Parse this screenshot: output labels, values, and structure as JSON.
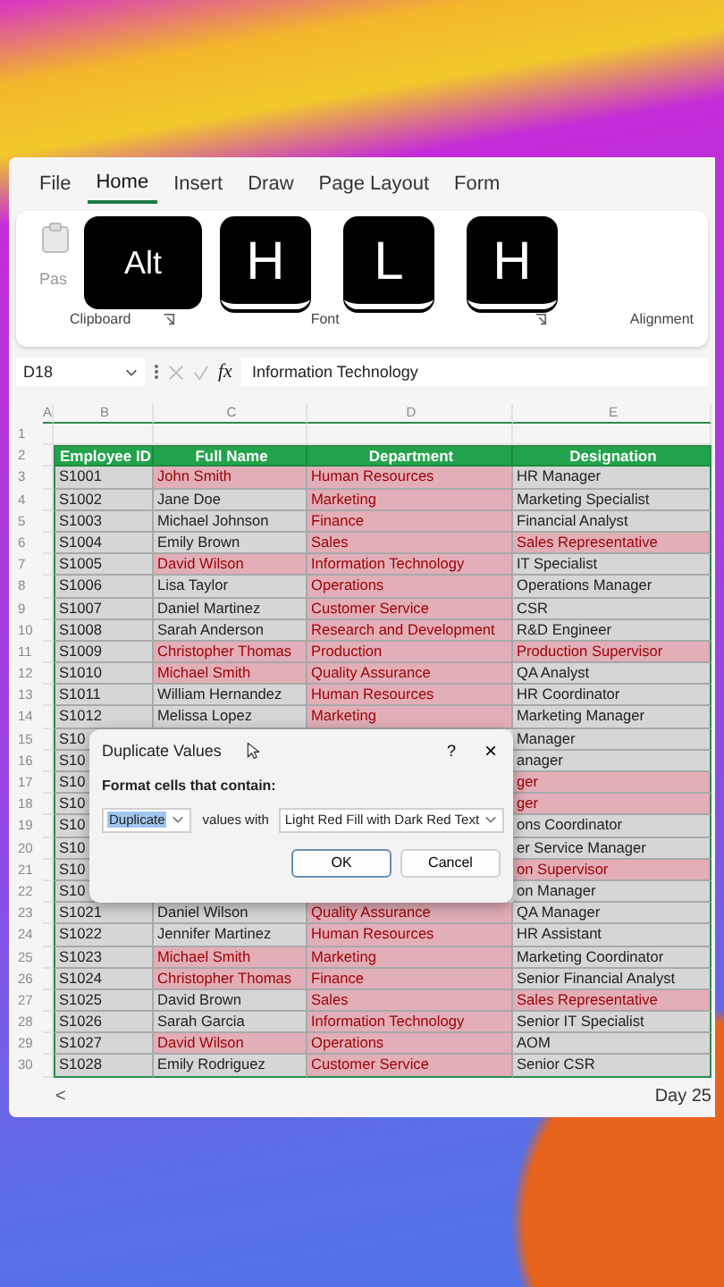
{
  "ribbon_tabs": [
    {
      "label": "File",
      "selected": false
    },
    {
      "label": "Home",
      "selected": true
    },
    {
      "label": "Insert",
      "selected": false
    },
    {
      "label": "Draw",
      "selected": false
    },
    {
      "label": "Page Layout",
      "selected": false
    },
    {
      "label": "Form",
      "selected": false
    }
  ],
  "ribbon": {
    "paste_label": "Pas",
    "groups": [
      "Clipboard",
      "Font",
      "Alignment"
    ]
  },
  "key_overlay": [
    "Alt",
    "H",
    "L",
    "H"
  ],
  "formula_bar": {
    "name_box": "D18",
    "fx": "fx",
    "formula": "Information Technology"
  },
  "sheet": {
    "columns": [
      "A",
      "B",
      "C",
      "D",
      "E"
    ],
    "rows": [
      {
        "number": "1",
        "kind": "empty",
        "cells": []
      },
      {
        "number": "2",
        "kind": "header",
        "cells": [
          null,
          {
            "text": "Employee ID"
          },
          {
            "text": "Full Name"
          },
          {
            "text": "Department"
          },
          {
            "text": "Designation"
          }
        ]
      },
      {
        "number": "3",
        "kind": "data",
        "cells": [
          null,
          {
            "text": "S1001",
            "duplicate": false
          },
          {
            "text": "John Smith",
            "duplicate": true
          },
          {
            "text": "Human Resources",
            "duplicate": true
          },
          {
            "text": "HR Manager",
            "duplicate": false
          }
        ]
      },
      {
        "number": "4",
        "kind": "data",
        "cells": [
          null,
          {
            "text": "S1002",
            "duplicate": false
          },
          {
            "text": "Jane Doe",
            "duplicate": false
          },
          {
            "text": "Marketing",
            "duplicate": true
          },
          {
            "text": "Marketing Specialist",
            "duplicate": false
          }
        ]
      },
      {
        "number": "5",
        "kind": "data",
        "cells": [
          null,
          {
            "text": "S1003",
            "duplicate": false
          },
          {
            "text": "Michael Johnson",
            "duplicate": false
          },
          {
            "text": "Finance",
            "duplicate": true
          },
          {
            "text": "Financial Analyst",
            "duplicate": false
          }
        ]
      },
      {
        "number": "6",
        "kind": "data",
        "cells": [
          null,
          {
            "text": "S1004",
            "duplicate": false
          },
          {
            "text": "Emily Brown",
            "duplicate": false
          },
          {
            "text": "Sales",
            "duplicate": true
          },
          {
            "text": "Sales Representative",
            "duplicate": true
          }
        ]
      },
      {
        "number": "7",
        "kind": "data",
        "cells": [
          null,
          {
            "text": "S1005",
            "duplicate": false
          },
          {
            "text": "David Wilson",
            "duplicate": true
          },
          {
            "text": "Information Technology",
            "duplicate": true
          },
          {
            "text": "IT Specialist",
            "duplicate": false
          }
        ]
      },
      {
        "number": "8",
        "kind": "data",
        "cells": [
          null,
          {
            "text": "S1006",
            "duplicate": false
          },
          {
            "text": "Lisa Taylor",
            "duplicate": false
          },
          {
            "text": "Operations",
            "duplicate": true
          },
          {
            "text": "Operations Manager",
            "duplicate": false
          }
        ]
      },
      {
        "number": "9",
        "kind": "data",
        "cells": [
          null,
          {
            "text": "S1007",
            "duplicate": false
          },
          {
            "text": "Daniel Martinez",
            "duplicate": false
          },
          {
            "text": "Customer Service",
            "duplicate": true
          },
          {
            "text": "CSR",
            "duplicate": false
          }
        ]
      },
      {
        "number": "10",
        "kind": "data",
        "cells": [
          null,
          {
            "text": "S1008",
            "duplicate": false
          },
          {
            "text": "Sarah Anderson",
            "duplicate": false
          },
          {
            "text": "Research and Development",
            "duplicate": true
          },
          {
            "text": "R&D Engineer",
            "duplicate": false
          }
        ]
      },
      {
        "number": "11",
        "kind": "data",
        "cells": [
          null,
          {
            "text": "S1009",
            "duplicate": false
          },
          {
            "text": "Christopher Thomas",
            "duplicate": true
          },
          {
            "text": "Production",
            "duplicate": true
          },
          {
            "text": "Production Supervisor",
            "duplicate": true
          }
        ]
      },
      {
        "number": "12",
        "kind": "data",
        "cells": [
          null,
          {
            "text": "S1010",
            "duplicate": false
          },
          {
            "text": "Michael Smith",
            "duplicate": true
          },
          {
            "text": "Quality Assurance",
            "duplicate": true
          },
          {
            "text": "QA Analyst",
            "duplicate": false
          }
        ]
      },
      {
        "number": "13",
        "kind": "data",
        "cells": [
          null,
          {
            "text": "S1011",
            "duplicate": false
          },
          {
            "text": "William Hernandez",
            "duplicate": false
          },
          {
            "text": "Human Resources",
            "duplicate": true
          },
          {
            "text": "HR Coordinator",
            "duplicate": false
          }
        ]
      },
      {
        "number": "14",
        "kind": "data",
        "cells": [
          null,
          {
            "text": "S1012",
            "duplicate": false
          },
          {
            "text": "Melissa Lopez",
            "duplicate": false
          },
          {
            "text": "Marketing",
            "duplicate": true
          },
          {
            "text": "Marketing Manager",
            "duplicate": false
          }
        ]
      },
      {
        "number": "15",
        "kind": "data",
        "cells": [
          null,
          {
            "text": "S10",
            "duplicate": false
          },
          null,
          null,
          {
            "text": "Manager",
            "duplicate": false
          }
        ]
      },
      {
        "number": "16",
        "kind": "data",
        "cells": [
          null,
          {
            "text": "S10",
            "duplicate": false
          },
          null,
          null,
          {
            "text": "anager",
            "duplicate": false
          }
        ]
      },
      {
        "number": "17",
        "kind": "data",
        "cells": [
          null,
          {
            "text": "S10",
            "duplicate": false
          },
          null,
          null,
          {
            "text": "ger",
            "duplicate": true
          }
        ]
      },
      {
        "number": "18",
        "kind": "data",
        "cells": [
          null,
          {
            "text": "S10",
            "duplicate": false
          },
          null,
          null,
          {
            "text": "ger",
            "duplicate": true
          }
        ]
      },
      {
        "number": "19",
        "kind": "data",
        "cells": [
          null,
          {
            "text": "S10",
            "duplicate": false
          },
          null,
          null,
          {
            "text": "ons Coordinator",
            "duplicate": false
          }
        ]
      },
      {
        "number": "20",
        "kind": "data",
        "cells": [
          null,
          {
            "text": "S10",
            "duplicate": false
          },
          null,
          null,
          {
            "text": "er Service Manager",
            "duplicate": false
          }
        ]
      },
      {
        "number": "21",
        "kind": "data",
        "cells": [
          null,
          {
            "text": "S10",
            "duplicate": false
          },
          null,
          null,
          {
            "text": "on Supervisor",
            "duplicate": true
          }
        ]
      },
      {
        "number": "22",
        "kind": "data",
        "cells": [
          null,
          {
            "text": "S10",
            "duplicate": false
          },
          null,
          null,
          {
            "text": "on Manager",
            "duplicate": false
          }
        ]
      },
      {
        "number": "23",
        "kind": "data",
        "cells": [
          null,
          {
            "text": "S1021",
            "duplicate": false
          },
          {
            "text": "Daniel Wilson",
            "duplicate": false
          },
          {
            "text": "Quality Assurance",
            "duplicate": true
          },
          {
            "text": "QA Manager",
            "duplicate": false
          }
        ]
      },
      {
        "number": "24",
        "kind": "data",
        "cells": [
          null,
          {
            "text": "S1022",
            "duplicate": false
          },
          {
            "text": "Jennifer Martinez",
            "duplicate": false
          },
          {
            "text": "Human Resources",
            "duplicate": true
          },
          {
            "text": "HR Assistant",
            "duplicate": false
          }
        ]
      },
      {
        "number": "25",
        "kind": "data",
        "cells": [
          null,
          {
            "text": "S1023",
            "duplicate": false
          },
          {
            "text": "Michael Smith",
            "duplicate": true
          },
          {
            "text": "Marketing",
            "duplicate": true
          },
          {
            "text": "Marketing Coordinator",
            "duplicate": false
          }
        ]
      },
      {
        "number": "26",
        "kind": "data",
        "cells": [
          null,
          {
            "text": "S1024",
            "duplicate": false
          },
          {
            "text": "Christopher Thomas",
            "duplicate": true
          },
          {
            "text": "Finance",
            "duplicate": true
          },
          {
            "text": "Senior Financial Analyst",
            "duplicate": false
          }
        ]
      },
      {
        "number": "27",
        "kind": "data",
        "cells": [
          null,
          {
            "text": "S1025",
            "duplicate": false
          },
          {
            "text": "David Brown",
            "duplicate": false
          },
          {
            "text": "Sales",
            "duplicate": true
          },
          {
            "text": "Sales Representative",
            "duplicate": true
          }
        ]
      },
      {
        "number": "28",
        "kind": "data",
        "cells": [
          null,
          {
            "text": "S1026",
            "duplicate": false
          },
          {
            "text": "Sarah Garcia",
            "duplicate": false
          },
          {
            "text": "Information Technology",
            "duplicate": true
          },
          {
            "text": "Senior IT Specialist",
            "duplicate": false
          }
        ]
      },
      {
        "number": "29",
        "kind": "data",
        "cells": [
          null,
          {
            "text": "S1027",
            "duplicate": false
          },
          {
            "text": "David Wilson",
            "duplicate": true
          },
          {
            "text": "Operations",
            "duplicate": true
          },
          {
            "text": "AOM",
            "duplicate": false
          }
        ]
      },
      {
        "number": "30",
        "kind": "data",
        "cells": [
          null,
          {
            "text": "S1028",
            "duplicate": false
          },
          {
            "text": "Emily Rodriguez",
            "duplicate": false
          },
          {
            "text": "Customer Service",
            "duplicate": true
          },
          {
            "text": "Senior CSR",
            "duplicate": false
          }
        ]
      }
    ]
  },
  "dialog": {
    "title": "Duplicate Values",
    "help": "?",
    "close": "×",
    "prompt": "Format cells that contain:",
    "type_select": "Duplicate",
    "connector": "values with",
    "format_select": "Light Red Fill with Dark Red Text",
    "buttons": [
      {
        "label": "OK",
        "default": true
      },
      {
        "label": "Cancel",
        "default": false
      }
    ]
  },
  "sheet_tabs": {
    "nav": "<",
    "tabs": [
      "Day 25"
    ]
  }
}
